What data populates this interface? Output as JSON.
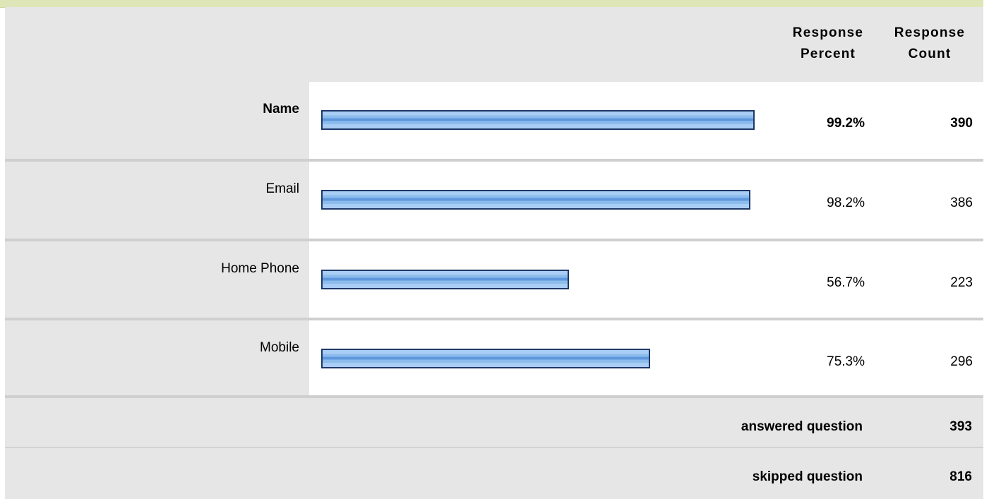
{
  "chart_data": {
    "type": "bar",
    "orientation": "horizontal",
    "columns": {
      "percent_header": [
        "Response",
        "Percent"
      ],
      "count_header": [
        "Response",
        "Count"
      ]
    },
    "categories": [
      "Name",
      "Email",
      "Home Phone",
      "Mobile"
    ],
    "percents": [
      99.2,
      98.2,
      56.7,
      75.3
    ],
    "percent_labels": [
      "99.2%",
      "98.2%",
      "56.7%",
      "75.3%"
    ],
    "counts": [
      "390",
      "386",
      "223",
      "296"
    ],
    "highlighted_category": "Name",
    "xlim": [
      0,
      100
    ],
    "summary": {
      "answered_label": "answered question",
      "answered_value": "393",
      "skipped_label": "skipped question",
      "skipped_value": "816"
    },
    "colors": {
      "bar_fill": "#8bbcec",
      "bar_border": "#1d3867",
      "row_background": "#e6e6e6",
      "top_band": "#dee6b8"
    }
  }
}
